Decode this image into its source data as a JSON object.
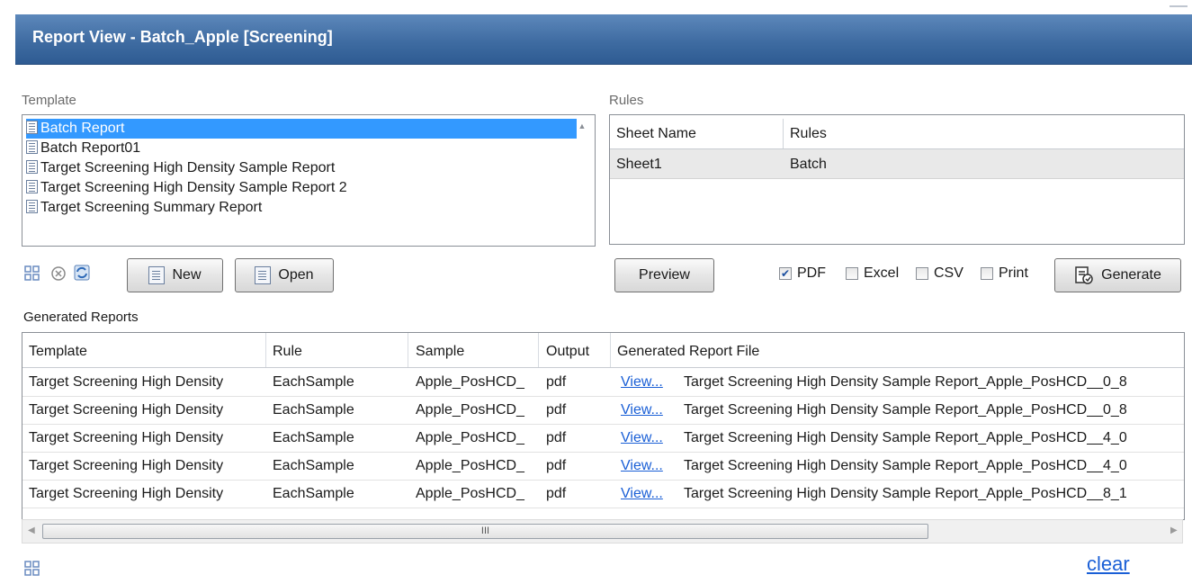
{
  "window": {
    "title_prefix": "Report View - ",
    "title_batch": "Batch_Apple",
    "title_suffix": " [Screening]"
  },
  "template_section": {
    "label": "Template",
    "items": [
      {
        "label": "Batch Report",
        "selected": true
      },
      {
        "label": "Batch Report01",
        "selected": false
      },
      {
        "label": "Target Screening High Density Sample Report",
        "selected": false
      },
      {
        "label": "Target Screening High Density Sample Report 2",
        "selected": false
      },
      {
        "label": "Target Screening Summary Report",
        "selected": false
      }
    ]
  },
  "rules_section": {
    "label": "Rules",
    "columns": [
      "Sheet Name",
      "Rules"
    ],
    "rows": [
      {
        "sheet_name": "Sheet1",
        "rules": "Batch"
      }
    ]
  },
  "toolbar": {
    "new_label": "New",
    "open_label": "Open",
    "preview_label": "Preview",
    "generate_label": "Generate",
    "options": [
      {
        "label": "PDF",
        "checked": true
      },
      {
        "label": "Excel",
        "checked": false
      },
      {
        "label": "CSV",
        "checked": false
      },
      {
        "label": "Print",
        "checked": false
      }
    ]
  },
  "generated_section": {
    "label": "Generated Reports",
    "columns": [
      "Template",
      "Rule",
      "Sample",
      "Output",
      "Generated Report File"
    ],
    "rows": [
      {
        "template": "Target Screening High Density",
        "rule": "EachSample",
        "sample": "Apple_PosHCD_",
        "output": "pdf",
        "view": "View...",
        "file": "Target Screening High Density Sample Report_Apple_PosHCD__0_8"
      },
      {
        "template": "Target Screening High Density",
        "rule": "EachSample",
        "sample": "Apple_PosHCD_",
        "output": "pdf",
        "view": "View...",
        "file": "Target Screening High Density Sample Report_Apple_PosHCD__0_8"
      },
      {
        "template": "Target Screening High Density",
        "rule": "EachSample",
        "sample": "Apple_PosHCD_",
        "output": "pdf",
        "view": "View...",
        "file": "Target Screening High Density Sample Report_Apple_PosHCD__4_0"
      },
      {
        "template": "Target Screening High Density",
        "rule": "EachSample",
        "sample": "Apple_PosHCD_",
        "output": "pdf",
        "view": "View...",
        "file": "Target Screening High Density Sample Report_Apple_PosHCD__4_0"
      },
      {
        "template": "Target Screening High Density",
        "rule": "EachSample",
        "sample": "Apple_PosHCD_",
        "output": "pdf",
        "view": "View...",
        "file": "Target Screening High Density Sample Report_Apple_PosHCD__8_1"
      }
    ],
    "scroll_grip": "III"
  },
  "footer": {
    "clear_label": "clear"
  },
  "colors": {
    "header_bg": "#3f6ca2",
    "selection": "#3399ff",
    "link": "#1a5fd6"
  },
  "icons": [
    "grid-icon",
    "remove-icon",
    "refresh-icon",
    "document-icon",
    "generate-icon"
  ]
}
